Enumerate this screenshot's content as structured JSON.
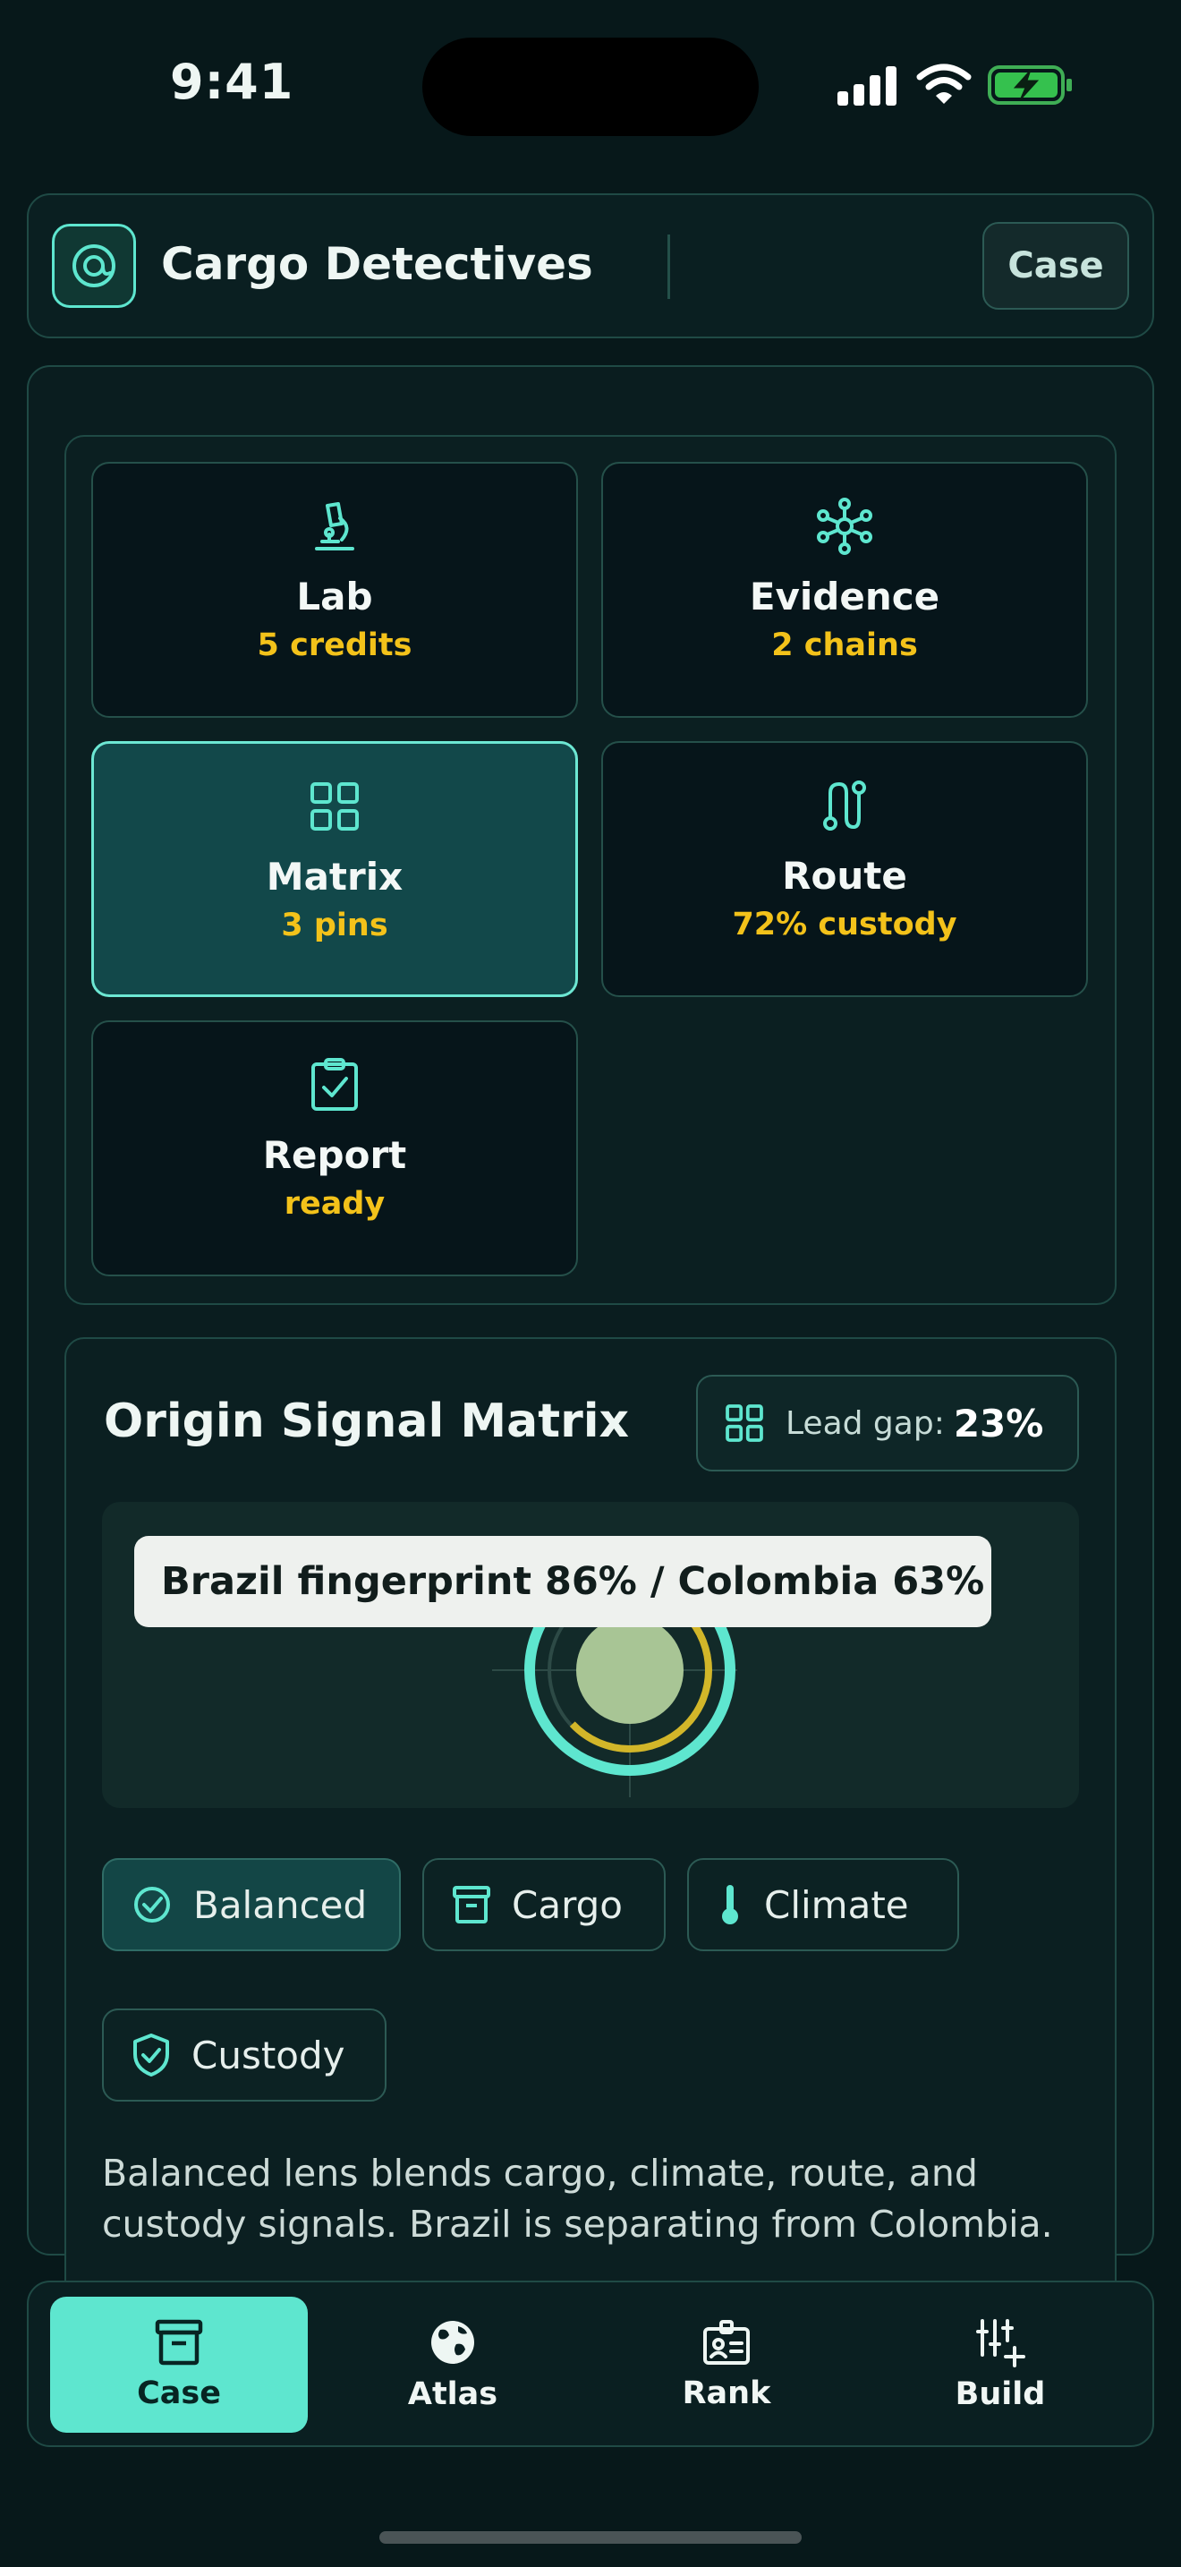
{
  "status_bar": {
    "time": "9:41"
  },
  "header": {
    "app_title": "Cargo Detectives",
    "case_button": "Case",
    "logo_icon": "target-icon"
  },
  "tiles": [
    {
      "label": "Lab",
      "sub": "5 credits",
      "icon": "microscope-icon",
      "active": false
    },
    {
      "label": "Evidence",
      "sub": "2 chains",
      "icon": "network-icon",
      "active": false
    },
    {
      "label": "Matrix",
      "sub": "3 pins",
      "icon": "grid-icon",
      "active": true
    },
    {
      "label": "Route",
      "sub": "72% custody",
      "icon": "route-icon",
      "active": false
    },
    {
      "label": "Report",
      "sub": "ready",
      "icon": "clipboard-check-icon",
      "active": false
    }
  ],
  "matrix": {
    "title": "Origin Signal Matrix",
    "lead_gap_label": "Lead gap:",
    "lead_gap_value": "23%",
    "tooltip": "Brazil fingerprint 86% / Colombia 63%",
    "brazil_score": 0.86,
    "colombia_score": 0.63,
    "lenses": [
      {
        "label": "Balanced",
        "icon": "check-circle-icon",
        "active": true
      },
      {
        "label": "Cargo",
        "icon": "archive-icon",
        "active": false
      },
      {
        "label": "Climate",
        "icon": "thermometer-icon",
        "active": false
      },
      {
        "label": "Custody",
        "icon": "shield-check-icon",
        "active": false
      }
    ],
    "description": "Balanced lens blends cargo, climate, route, and custody signals. Brazil is separating from Colombia."
  },
  "nav": [
    {
      "label": "Case",
      "icon": "archive-icon",
      "active": true
    },
    {
      "label": "Atlas",
      "icon": "globe-icon",
      "active": false
    },
    {
      "label": "Rank",
      "icon": "id-badge-icon",
      "active": false
    },
    {
      "label": "Build",
      "icon": "sliders-plus-icon",
      "active": false
    }
  ],
  "colors": {
    "accent": "#5ee6cf",
    "gold": "#f3c21a",
    "background": "#07181a"
  }
}
